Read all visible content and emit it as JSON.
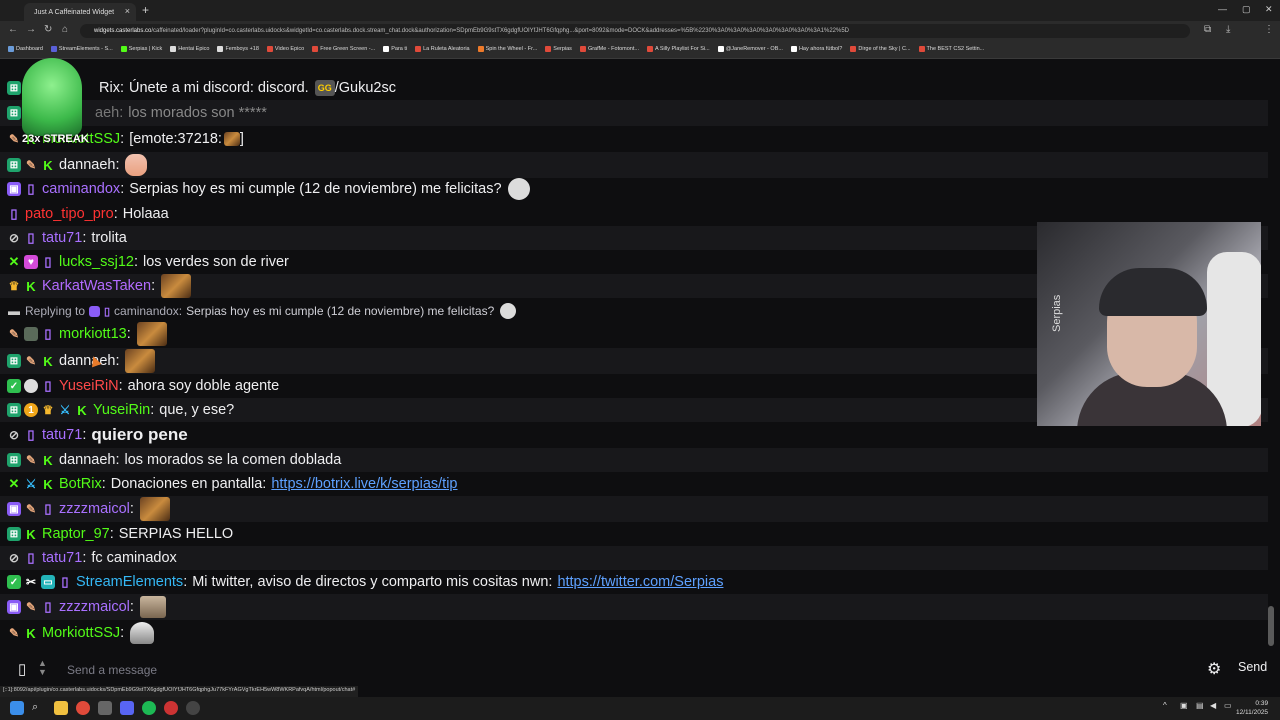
{
  "browser": {
    "tab_title": "Just A Caffeinated Widget",
    "url_host": "widgets.casterlabs.co",
    "url_rest": "/caffeinated/loader?pluginId=co.casterlabs.uidocks&widgetId=co.casterlabs.dock.stream_chat.dock&authorization=SDpmEb9G9stTX6gdgfUOIYfJHT6Gfqphg...&port=8092&mode=DOCK&addresses=%5B%2230%3A0%3A0%3A0%3A0%3A0%3A0%3A1%22%5D"
  },
  "bookmarks": [
    "Dashboard",
    "StreamElements - S...",
    "Serpias | Kick",
    "Hentai Epico",
    "Femboys +18",
    "Video Epico",
    "Free Green Screen -...",
    "Para ti",
    "La Ruleta Aleatoria",
    "Spin the Wheel - Fr...",
    "Serpias",
    "GrafMe - Fotomont...",
    "A Silly Playlist For Si...",
    "@JaneRemover - OB...",
    "Hay ahora fútbol?",
    "Dirge of the Sky | C...",
    "The BEST CS2 Settin..."
  ],
  "colors": {
    "green": "#53fc18",
    "purple": "#a970ff",
    "red": "#ff4a4a",
    "link": "#5ea1ff"
  },
  "overlay": {
    "streak": "23x STREAK"
  },
  "messages": [
    {
      "user": "Rix",
      "color": "#53fc18",
      "text": "Únete a mi discord: discord.",
      "emote": "GG",
      "text2": "/Guku2sc"
    },
    {
      "user": "aeh",
      "color": "#777",
      "text": "los morados son *****"
    },
    {
      "user": "MorkiottSSJ",
      "color": "#53fc18",
      "text": "[emote:37218:",
      "text2": "]"
    },
    {
      "user": "dannaeh",
      "color": "#efeff1",
      "text": ""
    },
    {
      "user": "caminandox",
      "color": "#a970ff",
      "text": "Serpias hoy es mi cumple (12 de noviembre) me felicitas?"
    },
    {
      "user": "pato_tipo_pro",
      "color": "#ff3333",
      "text": "Holaaa"
    },
    {
      "user": "tatu71",
      "color": "#a970ff",
      "text": "trolita"
    },
    {
      "user": "lucks_ssj12",
      "color": "#53fc18",
      "text": "los verdes son de river"
    },
    {
      "user": "KarkatWasTaken",
      "color": "#b36bff",
      "text": ""
    },
    {
      "reply_prefix": "Replying to",
      "reply_user": "caminandox",
      "reply_text": "Serpias hoy es mi cumple (12 de noviembre) me felicitas?"
    },
    {
      "user": "morkiott13",
      "color": "#53fc18",
      "text": ""
    },
    {
      "user": "dannaeh",
      "color": "#efeff1",
      "text": ""
    },
    {
      "user": "YuseiRiN",
      "color": "#ff4a4a",
      "text": "ahora soy doble agente"
    },
    {
      "user": "YuseiRin",
      "color": "#53fc18",
      "text": "que, y ese?"
    },
    {
      "user": "tatu71",
      "color": "#a970ff",
      "text": "quiero pene"
    },
    {
      "user": "dannaeh",
      "color": "#efeff1",
      "text": "los morados se la comen doblada"
    },
    {
      "user": "BotRix",
      "color": "#53fc18",
      "text": "Donaciones en pantalla:",
      "link": "https://botrix.live/k/serpias/tip"
    },
    {
      "user": "zzzzmaicol",
      "color": "#a970ff",
      "text": ""
    },
    {
      "user": "Raptor_97",
      "color": "#53fc18",
      "text": "SERPIAS HELLO"
    },
    {
      "user": "tatu71",
      "color": "#a970ff",
      "text": "fc caminadox"
    },
    {
      "user": "StreamElements",
      "color": "#35b8f5",
      "text": "Mi twitter, aviso de directos y comparto mis cositas nwn:",
      "link": "https://twitter.com/Serpias"
    },
    {
      "user": "zzzzmaicol",
      "color": "#a970ff",
      "text": ""
    },
    {
      "user": "MorkiottSSJ",
      "color": "#53fc18",
      "text": ""
    }
  ],
  "webcam": {
    "label": "Serpias"
  },
  "input": {
    "placeholder": "Send a message",
    "send_label": "Send"
  },
  "status_url": "[::1]:8092/api/plugin/co.casterlabs.uidocks/SDpmEb9G9stTX6gdgfUOIYfJHT6GfqphgJu77kFYrAGVgTkrEH5wW8WKRPafvqA/html/popout/chat#",
  "clock": {
    "time": "0:39",
    "date": "12/11/2025"
  }
}
